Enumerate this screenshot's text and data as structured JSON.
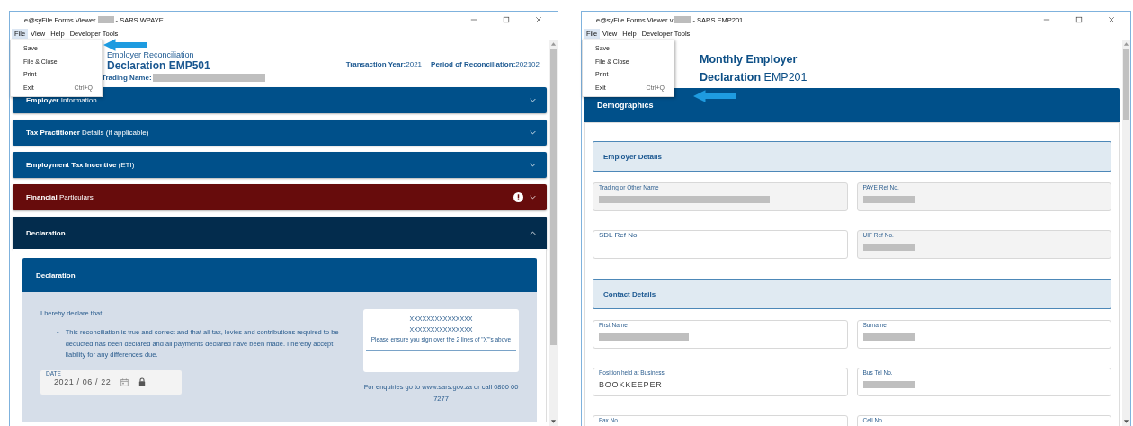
{
  "windows": [
    {
      "kind": "emp501",
      "title_start": "e@syFile Forms Viewer",
      "title_end": "- SARS WPAYE",
      "menu": [
        {
          "label": "File",
          "selected": true
        },
        {
          "label": "View",
          "selected": false
        },
        {
          "label": "Help",
          "selected": false
        },
        {
          "label": "Developer Tools",
          "selected": false
        }
      ],
      "file_menu": [
        {
          "label": "Save"
        },
        {
          "label": "File & Close"
        },
        {
          "label": "Print"
        },
        {
          "label": "Exit",
          "shortcut": "Ctrl+Q"
        }
      ],
      "form": {
        "subtitle": "Employer Reconciliation",
        "title": "Declaration EMP501",
        "trading_name_label": "Trading Name:",
        "transaction_year_label": "Transaction Year:",
        "transaction_year": "2021",
        "period_label": "Period of Reconciliation:",
        "period": "202102",
        "sections": [
          {
            "label": "**Employer** Information",
            "expanded": false,
            "alert": false
          },
          {
            "label": "**Tax Practitioner** Details (if applicable)",
            "expanded": false,
            "alert": false
          },
          {
            "label": "**Employment Tax Incentive** (ETI)",
            "expanded": false,
            "alert": false
          },
          {
            "label": "**Financial** Particulars",
            "expanded": false,
            "alert": true
          },
          {
            "label": "**Declaration**",
            "expanded": true,
            "alert": false
          }
        ],
        "declaration": {
          "heading": "Declaration",
          "intro": "I hereby declare that:",
          "bullets": [
            {
              "marker": "•",
              "text": "This reconciliation is true and correct and that all tax, levies and contributions required to be deducted has been declared and all payments declared have been made. I hereby accept liability for any differences due."
            }
          ],
          "date": {
            "label": "DATE",
            "value": "2021 / 06 / 22",
            "locked": true
          },
          "signature": {
            "lines": [
              "XXXXXXXXXXXXXXX",
              "XXXXXXXXXXXXXXX"
            ],
            "note": "Please ensure you sign over the 2 lines of \"X\"'s above"
          },
          "enquiries": "For enquiries go to www.sars.gov.za or call 0800 00 7277"
        }
      }
    },
    {
      "kind": "emp201",
      "title_start": "e@syFile Forms Viewer v",
      "title_end": "- SARS EMP201",
      "menu": [
        {
          "label": "File",
          "selected": true
        },
        {
          "label": "View",
          "selected": false
        },
        {
          "label": "Help",
          "selected": false
        },
        {
          "label": "Developer Tools",
          "selected": false
        }
      ],
      "file_menu": [
        {
          "label": "Save"
        },
        {
          "label": "File & Close"
        },
        {
          "label": "Print"
        },
        {
          "label": "Exit",
          "shortcut": "Ctrl+Q"
        }
      ],
      "form": {
        "heading": "**Monthly Employer Declaration** EMP201",
        "panel": "Demographics",
        "groups": [
          {
            "heading": "Employer Details",
            "fields": [
              {
                "label": "Trading or Other Name",
                "readonly": true,
                "redacted": true
              },
              {
                "label": "PAYE Ref No.",
                "readonly": true,
                "redacted": true
              },
              {
                "placeholder": "SDL Ref No.",
                "readonly": false
              },
              {
                "label": "UIF Ref No.",
                "readonly": true,
                "redacted": true
              }
            ]
          },
          {
            "heading": "Contact Details",
            "fields": [
              {
                "label": "First Name",
                "readonly": false,
                "redacted": true
              },
              {
                "label": "Surname",
                "readonly": false,
                "redacted": true
              },
              {
                "label": "Position held at Business",
                "readonly": false,
                "value": "BOOKKEEPER"
              },
              {
                "label": "Bus Tel No.",
                "readonly": false,
                "redacted": true
              },
              {
                "label": "Fax No.",
                "readonly": false
              },
              {
                "label": "Cell No.",
                "readonly": false
              }
            ]
          }
        ]
      }
    }
  ]
}
